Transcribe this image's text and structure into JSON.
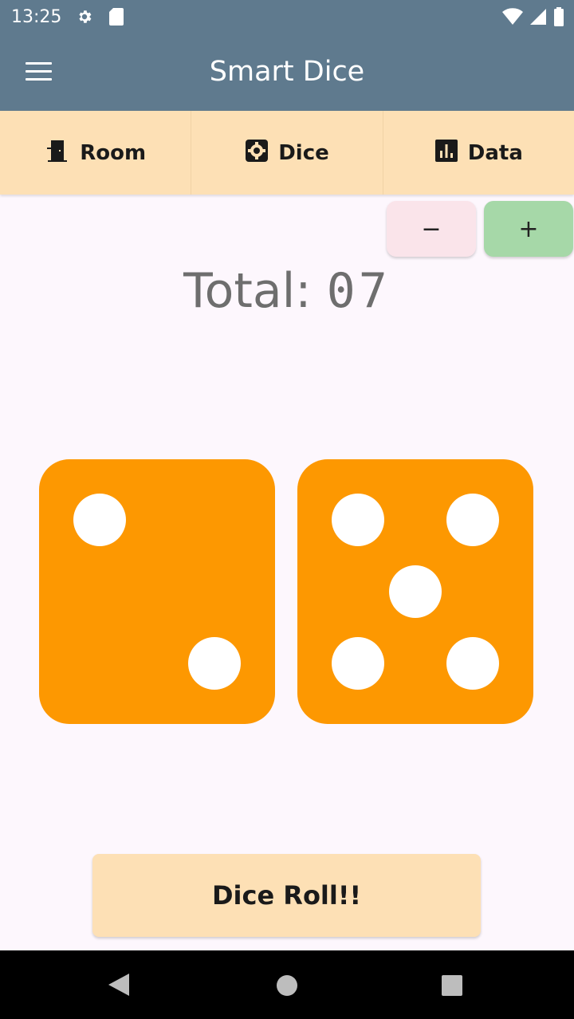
{
  "status_bar": {
    "time": "13:25"
  },
  "app_bar": {
    "title": "Smart Dice",
    "menu_icon": "hamburger-menu-icon"
  },
  "tabs": [
    {
      "label": "Room",
      "icon": "door-icon"
    },
    {
      "label": "Dice",
      "icon": "dice-gear-icon"
    },
    {
      "label": "Data",
      "icon": "bar-chart-icon"
    }
  ],
  "controls": {
    "minus_label": "−",
    "plus_label": "+"
  },
  "total": {
    "label": "Total:",
    "value": "07"
  },
  "dice": {
    "values": [
      2,
      5
    ],
    "color": "#fd9801",
    "pip_color": "#ffffff"
  },
  "roll_button": {
    "label": "Dice Roll!!"
  },
  "colors": {
    "app_bar": "#5f7a8e",
    "tab_bar": "#fde0b5",
    "minus": "#fae4ea",
    "plus": "#a6d8a8",
    "background": "#fdf7fd"
  }
}
